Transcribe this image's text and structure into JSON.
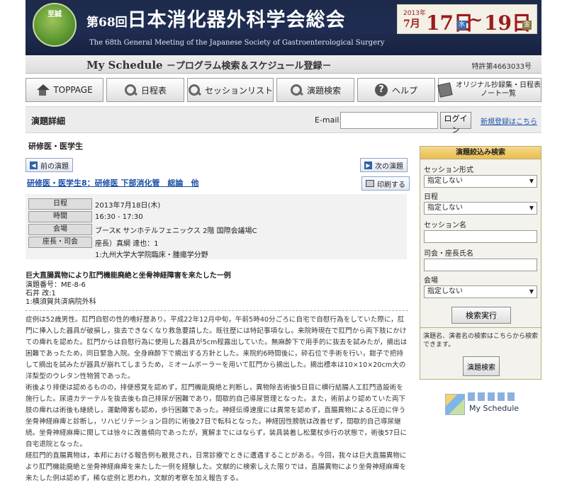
{
  "header": {
    "logo_text": "至誠",
    "title_small": "第68回",
    "title_main": "日本消化器外科学会総会",
    "subtitle": "The 68th General Meeting of the Japanese Society of Gastroenterological Surgery",
    "date_year": "2013年",
    "date_month": "7月",
    "date_start": "17日",
    "date_start_dow": "水",
    "date_tilde": "~",
    "date_end": "19日",
    "date_end_dow": "金"
  },
  "mystrip": {
    "title": "My Schedule",
    "subtitle": "－プログラム検索＆スケジュール登録－",
    "patent": "特許第4663033号"
  },
  "nav": {
    "items": [
      {
        "label": "TOPPAGE",
        "icon": "home-icon"
      },
      {
        "label": "日程表",
        "icon": "search-icon"
      },
      {
        "label": "セッションリスト",
        "icon": "search-icon"
      },
      {
        "label": "演題検索",
        "icon": "search-icon"
      },
      {
        "label": "ヘルプ",
        "icon": "help-icon"
      },
      {
        "label": "オリジナル抄録集・日程表",
        "label2": "ノート一覧",
        "icon": "note-icon"
      }
    ]
  },
  "detail_header": {
    "title": "演題詳細",
    "email_label": "E-mail:",
    "email_value": "",
    "login_label": "ログイン",
    "new_register": "新規登録はこちら"
  },
  "main": {
    "category": "研修医・医学生",
    "prev_label": "前の演題",
    "next_label": "次の演題",
    "print_label": "印刷する",
    "session_link": "研修医・医学生8：研修医 下部消化管　総論　他",
    "info": {
      "date_label": "日程",
      "date_value": "2013年7月18日(木)",
      "time_label": "時間",
      "time_value": "16:30 - 17:30",
      "venue_label": "会場",
      "venue_value": "ブースK サンホテルフェニックス 2階 国際会議場C",
      "chair_label": "座長・司会",
      "chair_value": "座長）真綱 達也：1",
      "chair_affil": "1:九州大学大学院臨床・腫瘍学分野"
    },
    "paper": {
      "title": "巨大直腸異物により肛門機能廃絶と坐骨神経障害を来たした一例",
      "number": "演題番号：ME-8-6",
      "author": "石井 改:1",
      "affiliation": "1:横須賀共済病院外科"
    },
    "abstract": [
      "症例は52歳男性。肛門自慰の性的嗜好歴あり。平成22年12月中旬，午前5時40分ごろに自宅で自慰行為をしていた際に，肛門に挿入した器具が破損し，抜去できなくなり救急要請した。既往歴には特記事項なし。来院時現在で肛門から両下肢にかけての痺れを認めた。肛門からは自慰行為に使用した器具が5cm程露出していた。無麻酔下で用手的に抜去を試みたが，摘出は困難であったため，同日緊急入院。全身麻酔下で摘出する方針とした。来院約6時間後に，砕石位で手術を行い，鉗子で把持して摘出を試みたが器具が崩れてしまうため，ミオームボーラーを用いて肛門から摘出した。摘出標本は10×10×20cm大の洋梨型のウレタン性物質であった。",
      "術後より排便は認めるものの，排便感覚を認めず，肛門機能廃絶と判断し，異物除去術後5日目に横行結腸人工肛門造設術を施行した。尿道カテーテルを抜去後も自己排尿が困難であり，間歇的自己導尿管理となった。また，術前より認めていた両下肢の痺れは術後も継続し，運動障害も認め，歩行困難であった。神経伝導速度には異常を認めず，直腸異物による圧迫に伴う坐骨神経麻痺と診断し，リハビリテーション目的に術後27日で転科となった。神経因性膀胱は改善せず，間歇的自己導尿継続。坐骨神経麻痺に関しては徐々に改善傾向であったが，寛解までにはならず，装具装着し松葉杖歩行の状態で，術後57日に自宅退院となった。",
      "経肛門的直腸異物は，本邦における報告例も散見され，日常診療でときに遭遇することがある。今回，我々は巨大直腸異物により肛門機能廃絶と坐骨神経麻痺を来たした一例を経験した。文献的に検索しえた限りでは，直腸異物により坐骨神経麻痺を来たした例は認めず，稀な症例と思われ，文献的考察を加え報告する。"
    ]
  },
  "sidebar": {
    "title": "演題絞込み検索",
    "session_type_label": "セッション形式",
    "session_type_value": "指定しない",
    "date_label": "日程",
    "date_value": "指定しない",
    "session_name_label": "セッション名",
    "chair_name_label": "司会・座長氏名",
    "venue_label": "会場",
    "venue_value": "指定しない",
    "search_button": "検索実行",
    "note": "演題名、演者名の検索はこちらから検索できます。",
    "title_search_button": "演題検索",
    "myschedule_label": "My Schedule"
  }
}
